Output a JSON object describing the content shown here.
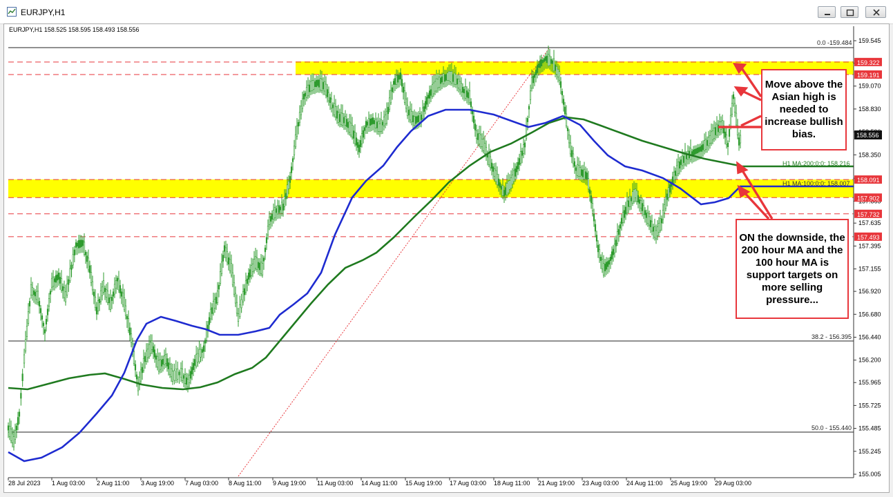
{
  "window": {
    "title": "EURJPY,H1"
  },
  "chart": {
    "header": "EURJPY,H1  158.525 158.595 158.493 158.556",
    "current_price": "158.556",
    "price_axis": [
      "159.545",
      "159.310",
      "159.070",
      "158.830",
      "158.590",
      "158.350",
      "158.105",
      "157.865",
      "157.635",
      "157.395",
      "157.155",
      "156.920",
      "156.680",
      "156.440",
      "156.200",
      "155.965",
      "155.725",
      "155.485",
      "155.245",
      "155.005"
    ],
    "time_axis": [
      "28 Jul 2023",
      "1 Aug 03:00",
      "2 Aug 11:00",
      "3 Aug 19:00",
      "7 Aug 03:00",
      "8 Aug 11:00",
      "9 Aug 19:00",
      "11 Aug 03:00",
      "14 Aug 11:00",
      "15 Aug 19:00",
      "17 Aug 03:00",
      "18 Aug 11:00",
      "21 Aug 19:00",
      "23 Aug 03:00",
      "24 Aug 11:00",
      "25 Aug 19:00",
      "29 Aug 03:00"
    ],
    "levels": [
      {
        "label": "159.322",
        "color": "#e8363b"
      },
      {
        "label": "159.191",
        "color": "#e8363b"
      },
      {
        "label": "158.091",
        "color": "#e8363b"
      },
      {
        "label": "157.902",
        "color": "#e8363b"
      },
      {
        "label": "157.732",
        "color": "#e8363b"
      },
      {
        "label": "157.493",
        "color": "#e8363b"
      }
    ],
    "fib": {
      "top": "0.0 -159.484",
      "mid": "38.2 - 156.395",
      "low": "50.0 - 155.440"
    },
    "ma": {
      "ma200": "H1 MA:200:0:0: 158.216",
      "ma100": "H1 MA:100:0:0: 158.007",
      "ma200_color": "#1f7a1f",
      "ma100_color": "#1e2bd0"
    },
    "candle_color": "#2e9b2e",
    "zone_color": "#ffff00"
  },
  "callouts": {
    "top": "Move above the Asian high is needed to increase bullish bias.",
    "bottom": "ON the downside, the 200 hour MA and the 100 hour MA is support targets on more selling pressure..."
  }
}
